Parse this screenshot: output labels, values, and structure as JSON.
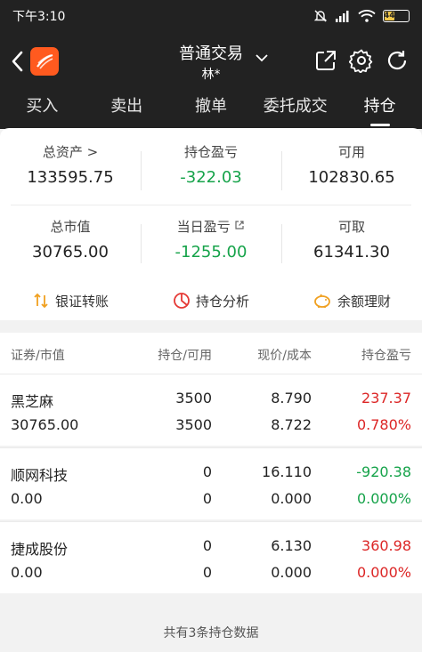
{
  "status_bar": {
    "time": "下午3:10",
    "battery": "44"
  },
  "nav": {
    "title": "普通交易",
    "account": "林*"
  },
  "tabs": [
    "买入",
    "卖出",
    "撤单",
    "委托成交",
    "持仓"
  ],
  "summary": {
    "total_assets_label": "总资产 >",
    "total_assets": "133595.75",
    "position_pnl_label": "持仓盈亏",
    "position_pnl": "-322.03",
    "available_label": "可用",
    "available": "102830.65",
    "market_value_label": "总市值",
    "market_value": "30765.00",
    "daily_pnl_label": "当日盈亏",
    "daily_pnl": "-1255.00",
    "withdrawable_label": "可取",
    "withdrawable": "61341.30"
  },
  "actions": [
    "银证转账",
    "持仓分析",
    "余额理财"
  ],
  "list_header": {
    "security": "证券/市值",
    "position": "持仓/可用",
    "price": "现价/成本",
    "pnl": "持仓盈亏"
  },
  "holdings": [
    {
      "name": "黑芝麻",
      "market_value": "30765.00",
      "position": "3500",
      "available": "3500",
      "price": "8.790",
      "cost": "8.722",
      "pnl": "237.37",
      "pnl_pct": "0.780%",
      "pnl_color": "#dc2626"
    },
    {
      "name": "顺网科技",
      "market_value": "0.00",
      "position": "0",
      "available": "0",
      "price": "16.110",
      "cost": "0.000",
      "pnl": "-920.38",
      "pnl_pct": "0.000%",
      "pnl_color": "#16a34a"
    },
    {
      "name": "捷成股份",
      "market_value": "0.00",
      "position": "0",
      "available": "0",
      "price": "6.130",
      "cost": "0.000",
      "pnl": "360.98",
      "pnl_pct": "0.000%",
      "pnl_color": "#dc2626"
    }
  ],
  "footer": "共有3条持仓数据",
  "colors": {
    "header_bg": "#222222",
    "profit": "#dc2626",
    "loss": "#16a34a",
    "brand": "#ff5a1f"
  }
}
